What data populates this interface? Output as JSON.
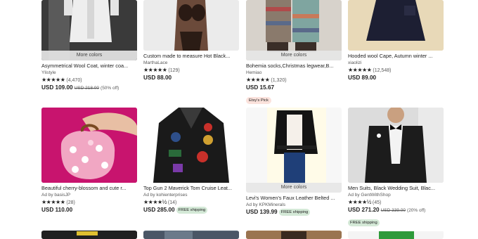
{
  "more_colors_label": "More colors",
  "row1": [
    {
      "title": "Asymmetrical Wool Coat, winter coa...",
      "shop": "Ylistyle",
      "stars": "★★★★★",
      "count": "(4,470)",
      "price": "USD 109.00",
      "orig": "USD 218.00",
      "off": "(50% off)",
      "more": true
    },
    {
      "title": "Custom made to measure Hot Black...",
      "shop": "MarthaLace",
      "stars": "★★★★★",
      "count": "(129)",
      "price": "USD 88.00"
    },
    {
      "title": "Bohemia socks,Christmas legwear,B...",
      "shop": "Hemiao",
      "stars": "★★★★★",
      "count": "(1,320)",
      "price": "USD 15.67",
      "pick": "Etsy's Pick",
      "more": true
    },
    {
      "title": "Hooded wool Cape, Autumn winter ...",
      "shop": "xiaolizi",
      "stars": "★★★★★",
      "count": "(12,548)",
      "price": "USD 89.00"
    }
  ],
  "row2": [
    {
      "title": "Beautiful cherry-blossom and cute r...",
      "shop": "Ad by basisJP",
      "stars": "★★★★★",
      "count": "(28)",
      "price": "USD 110.00"
    },
    {
      "title": "Top Gun 2 Maverick Tom Cruise Leat...",
      "shop": "Ad by kohienterprises",
      "stars": "★★★★½",
      "count": "(14)",
      "price": "USD 285.00",
      "badge": "FREE shipping"
    },
    {
      "title": "Levi's Women's Faux Leather Belted ...",
      "shop": "Ad by KPKMinerals",
      "stars": "",
      "count": "",
      "price": "USD 139.99",
      "badge": "FREE shipping",
      "more": true
    },
    {
      "title": "Men Suits, Black Wedding Suit, Blac...",
      "shop": "Ad by GentWithShop",
      "stars": "★★★★½",
      "count": "(45)",
      "price": "USD 271.20",
      "orig": "USD 339.00",
      "off": "(20% off)",
      "freeship": "FREE shipping"
    }
  ]
}
